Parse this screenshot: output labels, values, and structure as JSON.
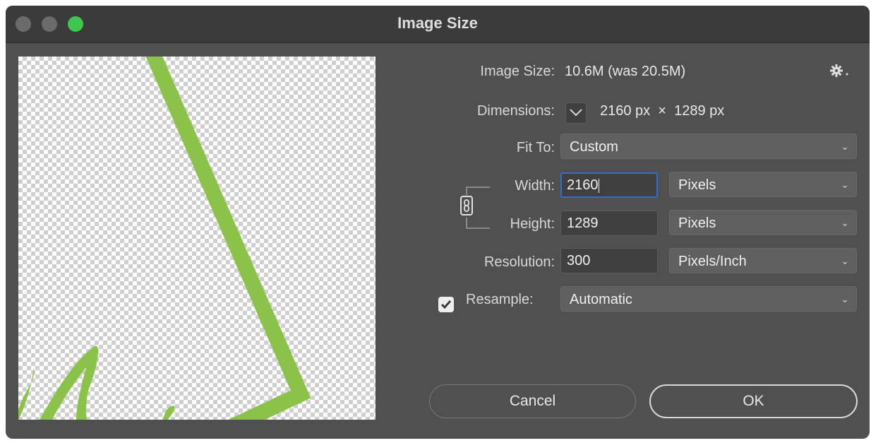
{
  "window": {
    "title": "Image Size"
  },
  "image_size": {
    "label": "Image Size:",
    "value": "10.6M (was 20.5M)"
  },
  "dimensions": {
    "label": "Dimensions:",
    "value": "2160 px  ×  1289 px"
  },
  "fit_to": {
    "label": "Fit To:",
    "value": "Custom"
  },
  "width": {
    "label": "Width:",
    "value": "2160",
    "unit": "Pixels"
  },
  "height": {
    "label": "Height:",
    "value": "1289",
    "unit": "Pixels"
  },
  "resolution": {
    "label": "Resolution:",
    "value": "300",
    "unit": "Pixels/Inch"
  },
  "resample": {
    "label": "Resample:",
    "checked": true,
    "value": "Automatic"
  },
  "buttons": {
    "cancel": "Cancel",
    "ok": "OK"
  },
  "colors": {
    "accent": "#2d6fd6",
    "preview_art": "#8bc34a",
    "zoom_button": "#3dc84d"
  },
  "icons": {
    "settings": "gear-icon",
    "dimensions_toggle": "chevron-down-icon",
    "constrain": "chain-link-icon",
    "dropdown": "chevron-down-icon",
    "checkbox": "checkmark-icon"
  }
}
